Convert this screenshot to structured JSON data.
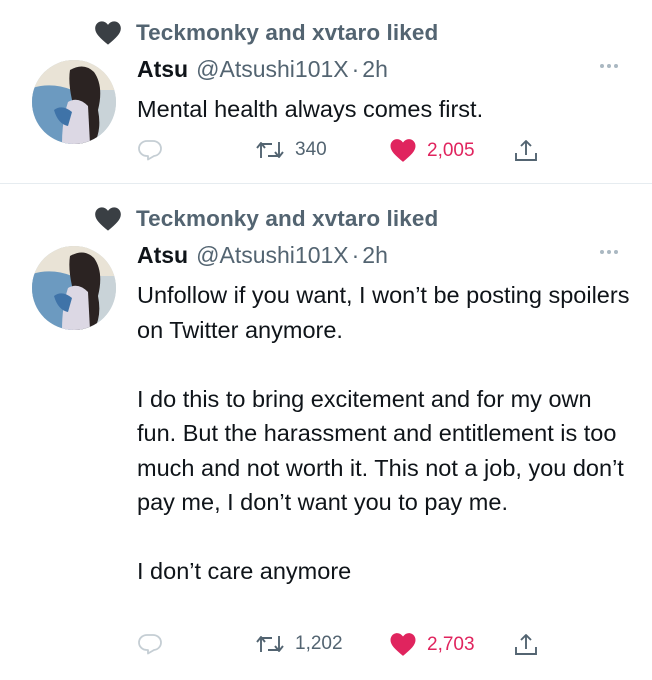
{
  "tweets": [
    {
      "social_context": "Teckmonky and xvtaro liked",
      "display_name": "Atsu",
      "handle": "@Atsushi101X",
      "separator": "·",
      "time": "2h",
      "paragraphs": [
        "Mental health always comes first."
      ],
      "retweets": "340",
      "likes": "2,005"
    },
    {
      "social_context": "Teckmonky and xvtaro liked",
      "display_name": "Atsu",
      "handle": "@Atsushi101X",
      "separator": "·",
      "time": "2h",
      "paragraphs": [
        "Unfollow if you want, I won’t be posting spoilers on Twitter anymore.",
        "I do this to bring excitement and for my own fun. But the harassment and entitlement is too much and not worth it. This not a job, you don’t pay me, I don’t want you to pay me.",
        "I don’t care anymore"
      ],
      "retweets": "1,202",
      "likes": "2,703"
    }
  ],
  "colors": {
    "text": "#0f1419",
    "secondary": "#536471",
    "like": "#e0245e",
    "divider": "#e6ecf0"
  },
  "icons": [
    "heart-icon",
    "reply-icon",
    "retweet-icon",
    "like-icon",
    "share-icon",
    "more-icon"
  ]
}
